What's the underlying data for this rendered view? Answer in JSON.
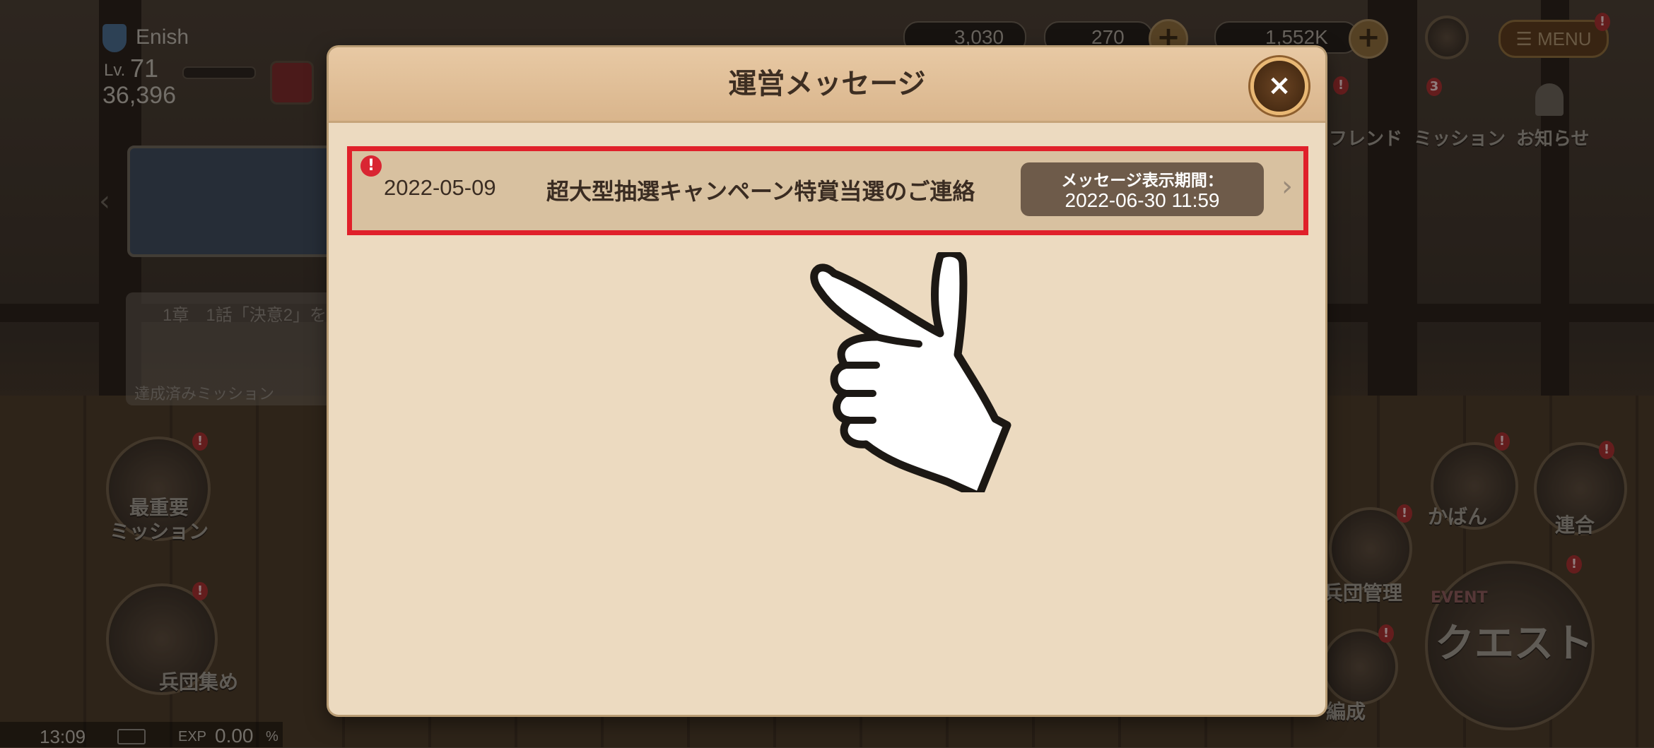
{
  "hud": {
    "player_name": "Enish",
    "level_label": "Lv.",
    "level_value": "71",
    "power": "36,396",
    "currency_red": "3,030",
    "currency_blue": "270",
    "currency_gold": "1,552K",
    "menu_label": "☰ MENU",
    "friend_label": "フレンド",
    "mission_label": "ミッション",
    "mission_badge": "3",
    "news_label": "お知らせ",
    "mission_panel_title": "1章　1話「決意2」を",
    "mission_panel_link": "達成済みミッション",
    "top_mission_label": "最重要\nミッション",
    "gather_label": "兵団集め",
    "bag_label": "かばん",
    "alliance_label": "連合",
    "corps_label": "兵団管理",
    "formation_label": "編成",
    "quest_label": "クエスト",
    "event_label": "EVENT",
    "clock": "13:09",
    "exp_label": "EXP",
    "exp_value": "0.00",
    "exp_unit": "%"
  },
  "modal": {
    "title": "運営メッセージ",
    "close_symbol": "×",
    "messages": [
      {
        "alert": "!",
        "date": "2022-05-09",
        "title": "超大型抽選キャンペーン特賞当選のご連絡",
        "period_label": "メッセージ表示期間：",
        "period_value": "2022-06-30 11:59",
        "chevron": "›"
      }
    ]
  },
  "colors": {
    "highlight": "#e0202a",
    "modal_bg": "#ecdac0",
    "header_bg": "#d9b58c",
    "period_box": "#6e5b4a",
    "alert": "#d92532"
  },
  "icons": [
    "close-icon",
    "alert-icon",
    "chevron-right-icon",
    "pointing-hand-icon",
    "shield-icon",
    "home-icon",
    "bell-icon"
  ]
}
